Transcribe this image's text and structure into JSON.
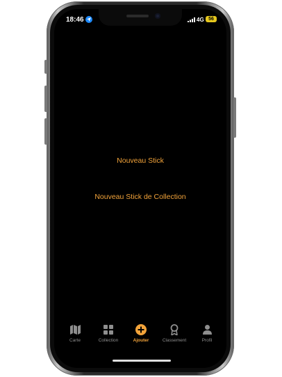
{
  "status": {
    "time": "18:46",
    "network": "4G",
    "battery": "56"
  },
  "actions": {
    "new_stick": "Nouveau Stick",
    "new_collection_stick": "Nouveau Stick de Collection"
  },
  "tabs": [
    {
      "label": "Carte",
      "icon": "map-icon",
      "active": false
    },
    {
      "label": "Collection",
      "icon": "grid-icon",
      "active": false
    },
    {
      "label": "Ajouter",
      "icon": "plus-circle-icon",
      "active": true
    },
    {
      "label": "Classement",
      "icon": "award-icon",
      "active": false
    },
    {
      "label": "Profil",
      "icon": "person-icon",
      "active": false
    }
  ],
  "colors": {
    "accent": "#f2a33a",
    "inactive": "#8e8e8e",
    "background": "#000000"
  }
}
